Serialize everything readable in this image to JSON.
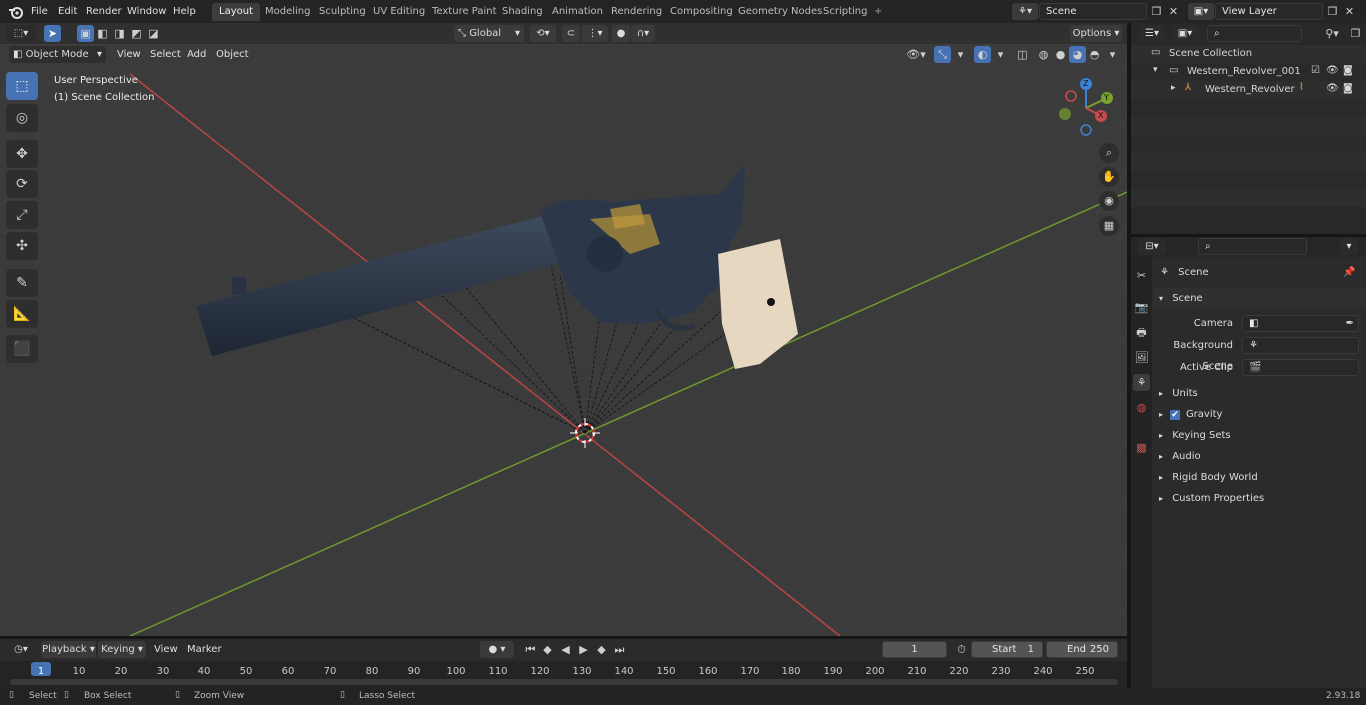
{
  "topbar": {
    "menus": [
      "File",
      "Edit",
      "Render",
      "Window",
      "Help"
    ],
    "workspaces": [
      "Layout",
      "Modeling",
      "Sculpting",
      "UV Editing",
      "Texture Paint",
      "Shading",
      "Animation",
      "Rendering",
      "Compositing",
      "Geometry Nodes",
      "Scripting"
    ],
    "add_tab": "+",
    "scene": "Scene",
    "view_layer": "View Layer"
  },
  "viewport": {
    "mode": "Object Mode",
    "menus": [
      "View",
      "Select",
      "Add",
      "Object"
    ],
    "orientation": "Global",
    "options": "Options",
    "overlay_line1": "User Perspective",
    "overlay_line2": "(1) Scene Collection",
    "gizmo": {
      "x": "X",
      "y": "Y",
      "z": "Z"
    }
  },
  "outliner": {
    "root": "Scene Collection",
    "items": [
      {
        "label": "Western_Revolver_001"
      },
      {
        "label": "Western_Revolver"
      }
    ]
  },
  "properties": {
    "header": "Scene",
    "panel": "Scene",
    "camera_label": "Camera",
    "bg_scene_label": "Background Scene",
    "active_clip_label": "Active Clip",
    "sections": [
      "Units",
      "Gravity",
      "Keying Sets",
      "Audio",
      "Rigid Body World",
      "Custom Properties"
    ]
  },
  "timeline": {
    "menus": [
      "Playback",
      "Keying",
      "View",
      "Marker"
    ],
    "current_frame": "1",
    "start_label": "Start",
    "start": "1",
    "end_label": "End",
    "end": "250",
    "ticks": [
      "1",
      "10",
      "20",
      "30",
      "40",
      "50",
      "60",
      "70",
      "80",
      "90",
      "100",
      "110",
      "120",
      "130",
      "140",
      "150",
      "160",
      "170",
      "180",
      "190",
      "200",
      "210",
      "220",
      "230",
      "240",
      "250"
    ]
  },
  "status": {
    "select": "Select",
    "box_select": "Box Select",
    "zoom_view": "Zoom View",
    "lasso_select": "Lasso Select",
    "version": "2.93.18"
  },
  "colors": {
    "accent": "#4772b3",
    "x_axis": "#c84b4b",
    "y_axis": "#7aa02f",
    "z_axis": "#3b82d6"
  }
}
